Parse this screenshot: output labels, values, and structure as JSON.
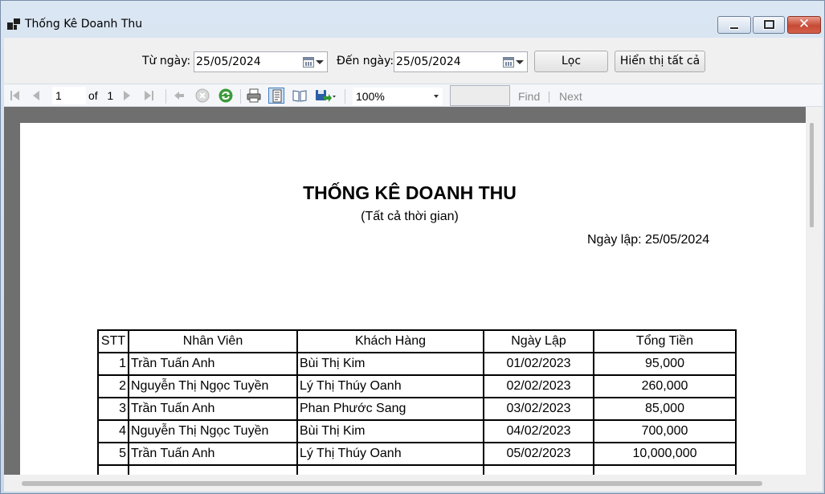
{
  "window": {
    "title": "Thống Kê Doanh Thu",
    "close_glyph": "✕"
  },
  "filter": {
    "from_label": "Từ ngày:",
    "from_value": "25/05/2024",
    "to_label": "Đến ngày:",
    "to_value": "25/05/2024",
    "filter_button": "Lọc",
    "show_all_button": "Hiển thị tất cả"
  },
  "toolbar": {
    "page_number": "1",
    "of_label": "of",
    "total_pages": "1",
    "zoom": "100%",
    "find_label": "Find",
    "next_label": "Next",
    "icons": [
      "first-page-icon",
      "previous-page-icon",
      "next-page-icon",
      "last-page-icon",
      "back-icon",
      "stop-icon",
      "refresh-icon",
      "print-icon",
      "print-layout-icon",
      "page-setup-icon",
      "export-icon"
    ]
  },
  "report": {
    "title": "THỐNG KÊ DOANH THU",
    "subtitle": "(Tất cả thời gian)",
    "date_label": "Ngày lập: 25/05/2024",
    "columns": [
      "STT",
      "Nhân Viên",
      "Khách Hàng",
      "Ngày Lập",
      "Tổng Tiền"
    ],
    "rows": [
      [
        "1",
        "Trần Tuấn Anh",
        "Bùi Thị Kim",
        "01/02/2023",
        "95,000"
      ],
      [
        "2",
        "Nguyễn Thị Ngọc Tuyền",
        "Lý Thị Thúy Oanh",
        "02/02/2023",
        "260,000"
      ],
      [
        "3",
        "Trần Tuấn Anh",
        "Phan Phước Sang",
        "03/02/2023",
        "85,000"
      ],
      [
        "4",
        "Nguyễn Thị Ngọc Tuyền",
        "Bùi Thị Kim",
        "04/02/2023",
        "700,000"
      ],
      [
        "5",
        "Trần Tuấn Anh",
        "Lý Thị Thúy Oanh",
        "05/02/2023",
        "10,000,000"
      ]
    ]
  },
  "colors": {
    "close_button": "#c64a35",
    "viewer_background": "#6f6f6f",
    "titlebar": "#c8d8ea"
  }
}
